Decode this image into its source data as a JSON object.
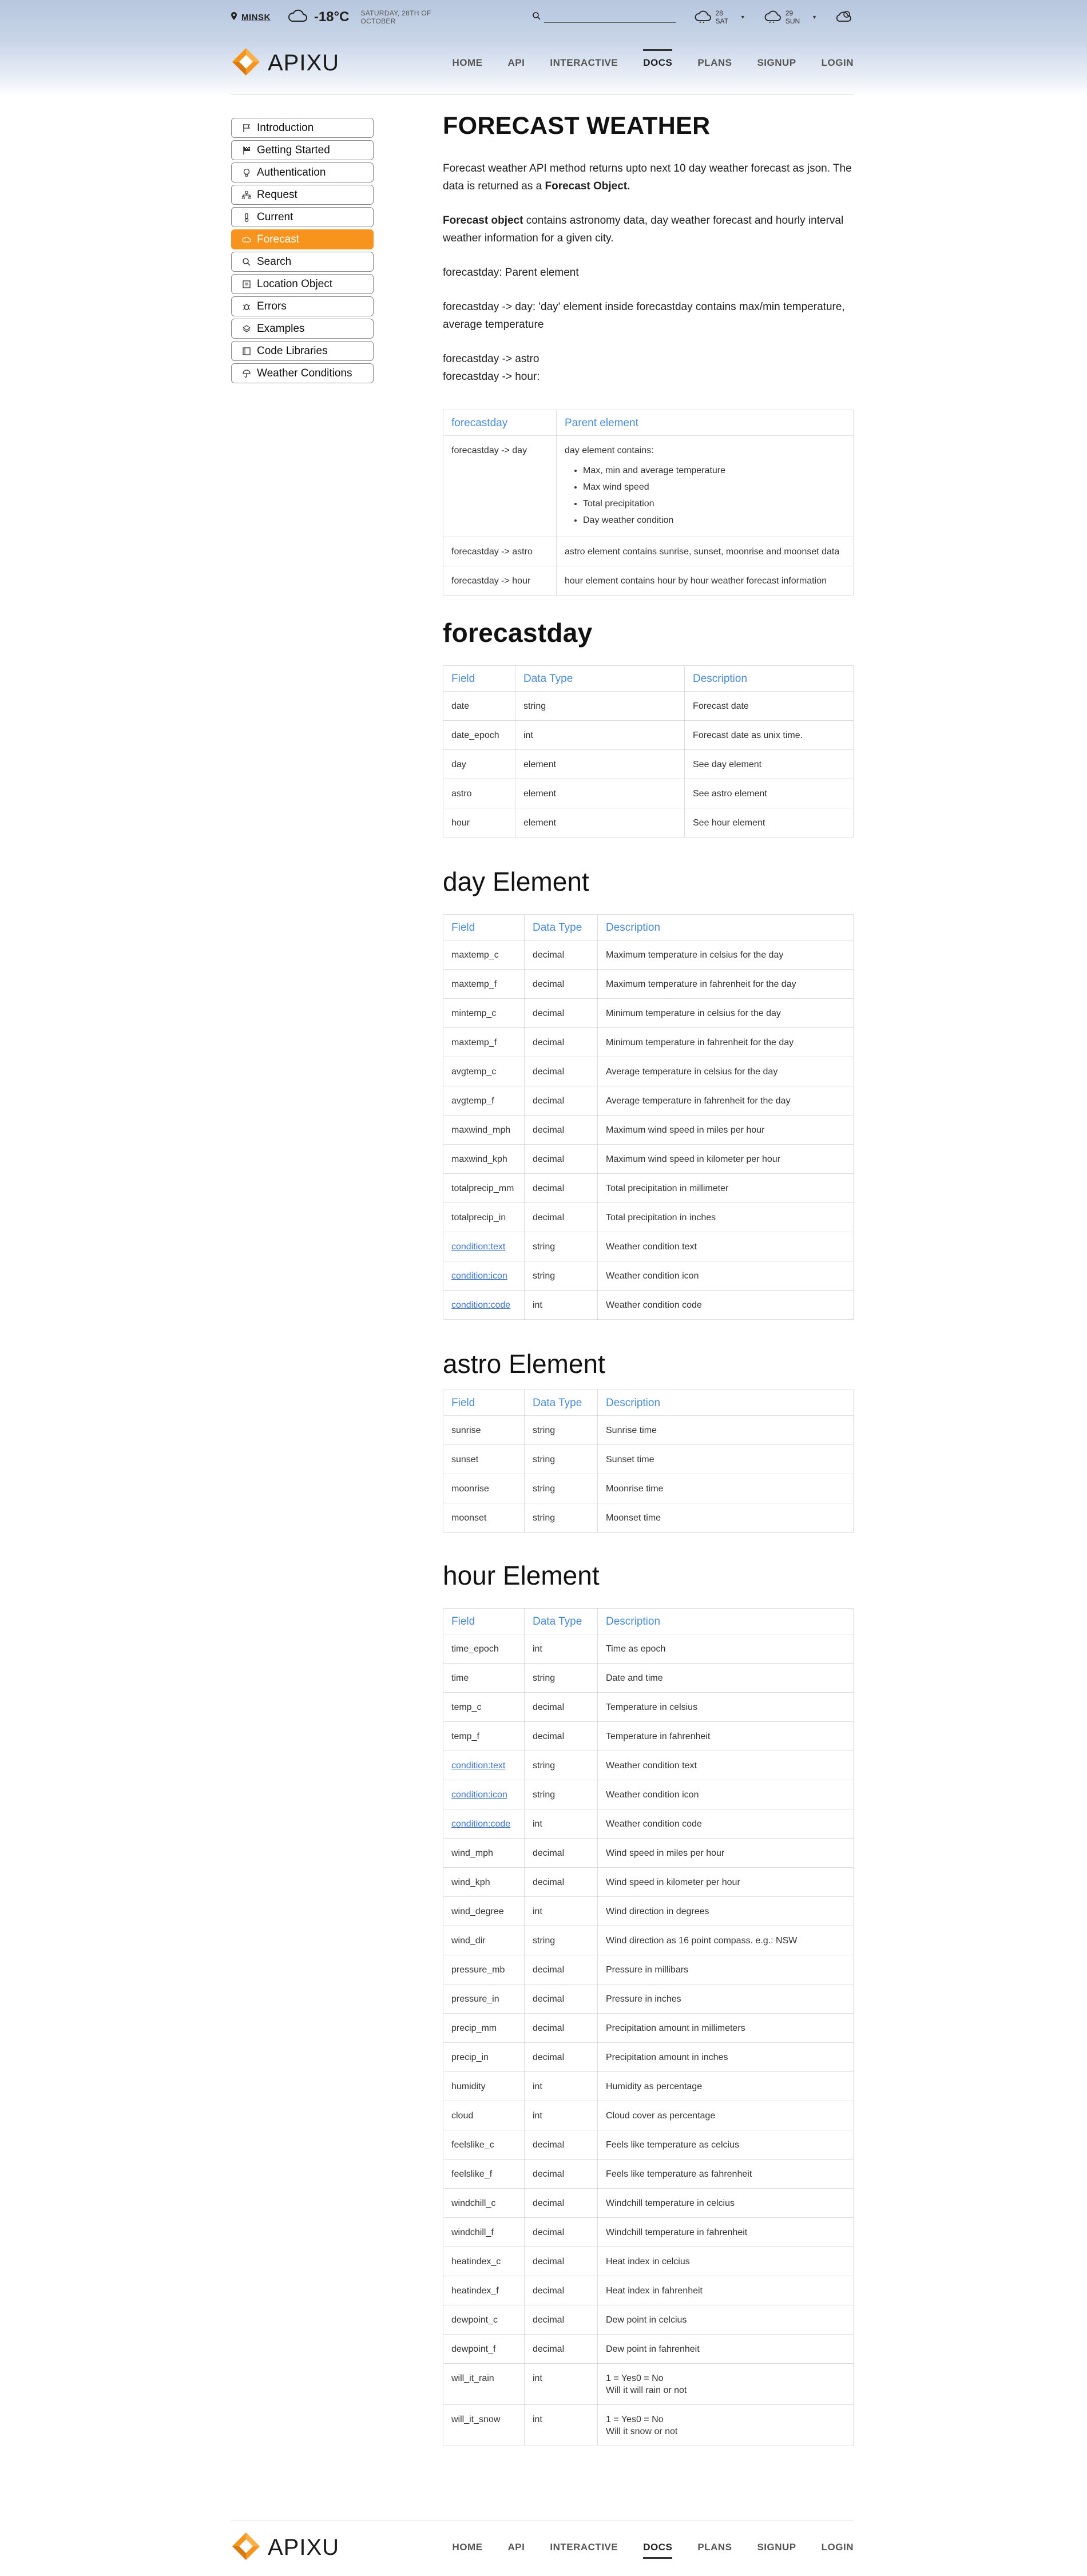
{
  "topbar": {
    "city": "MINSK",
    "temperature": "-18°C",
    "date": "SATURDAY, 28TH OF OCTOBER",
    "search_placeholder": "",
    "forecast_1": "28 SAT",
    "forecast_2": "29 SUN"
  },
  "brand": {
    "name": "APIXU",
    "logo_color": "#f7941d"
  },
  "nav": {
    "items": [
      {
        "label": "HOME"
      },
      {
        "label": "API"
      },
      {
        "label": "INTERACTIVE"
      },
      {
        "label": "DOCS",
        "active": true
      },
      {
        "label": "PLANS"
      },
      {
        "label": "SIGNUP"
      },
      {
        "label": "LOGIN"
      }
    ]
  },
  "sidebar": {
    "items": [
      {
        "label": "Introduction",
        "icon": "flag-icon"
      },
      {
        "label": "Getting Started",
        "icon": "checkered-flag-icon"
      },
      {
        "label": "Authentication",
        "icon": "lightbulb-icon"
      },
      {
        "label": "Request",
        "icon": "sitemap-icon"
      },
      {
        "label": "Current",
        "icon": "thermometer-icon"
      },
      {
        "label": "Forecast",
        "icon": "cloud-icon",
        "active": true
      },
      {
        "label": "Search",
        "icon": "search-icon"
      },
      {
        "label": "Location Object",
        "icon": "list-icon"
      },
      {
        "label": "Errors",
        "icon": "bug-icon"
      },
      {
        "label": "Examples",
        "icon": "layers-icon"
      },
      {
        "label": "Code Libraries",
        "icon": "book-icon"
      },
      {
        "label": "Weather Conditions",
        "icon": "umbrella-icon"
      }
    ],
    "active_color": "#f7941d"
  },
  "content": {
    "title": "FORECAST WEATHER",
    "intro_1": "Forecast weather API method returns upto next 10 day weather forecast as json. The data is returned as a ",
    "intro_1_bold": "Forecast Object.",
    "intro_2_bold": "Forecast object",
    "intro_2": " contains astronomy data, day weather forecast and hourly interval weather information for a given city.",
    "line_parent": "forecastday: Parent element",
    "line_day": "forecastday -> day: 'day' element inside forecastday contains max/min temperature, average temperature",
    "line_astro": "forecastday -> astro",
    "line_hour": "forecastday -> hour:"
  },
  "parent_table": {
    "headers": [
      "forecastday",
      "Parent element"
    ],
    "rows": [
      {
        "field": "forecastday -> day",
        "desc": "day element contains:",
        "bullets": [
          "Max, min and average temperature",
          "Max wind speed",
          "Total precipitation",
          "Day weather condition"
        ]
      },
      {
        "field": "forecastday -> astro",
        "desc": "astro element contains sunrise, sunset, moonrise and moonset data"
      },
      {
        "field": "forecastday -> hour",
        "desc": "hour element contains hour by hour weather forecast information"
      }
    ]
  },
  "forecastday_section": {
    "title": "forecastday",
    "headers": [
      "Field",
      "Data Type",
      "Description"
    ],
    "rows": [
      [
        "date",
        "string",
        "Forecast date"
      ],
      [
        "date_epoch",
        "int",
        "Forecast date as unix time."
      ],
      [
        "day",
        "element",
        "See day element"
      ],
      [
        "astro",
        "element",
        "See astro element"
      ],
      [
        "hour",
        "element",
        "See hour element"
      ]
    ]
  },
  "day_section": {
    "title": "day Element",
    "headers": [
      "Field",
      "Data Type",
      "Description"
    ],
    "rows": [
      [
        "maxtemp_c",
        "decimal",
        "Maximum temperature in celsius for the day"
      ],
      [
        "maxtemp_f",
        "decimal",
        "Maximum temperature in fahrenheit for the day"
      ],
      [
        "mintemp_c",
        "decimal",
        "Minimum temperature in celsius for the day"
      ],
      [
        "maxtemp_f",
        "decimal",
        "Minimum temperature in fahrenheit for the day"
      ],
      [
        "avgtemp_c",
        "decimal",
        "Average temperature in celsius for the day"
      ],
      [
        "avgtemp_f",
        "decimal",
        "Average temperature in fahrenheit for the day"
      ],
      [
        "maxwind_mph",
        "decimal",
        "Maximum wind speed in miles per hour"
      ],
      [
        "maxwind_kph",
        "decimal",
        "Maximum wind speed in kilometer per hour"
      ],
      [
        "totalprecip_mm",
        "decimal",
        "Total precipitation in millimeter"
      ],
      [
        "totalprecip_in",
        "decimal",
        "Total precipitation in inches"
      ],
      [
        "condition:text",
        "string",
        "Weather condition text"
      ],
      [
        "condition:icon",
        "string",
        "Weather condition icon"
      ],
      [
        "condition:code",
        "int",
        "Weather condition code"
      ]
    ]
  },
  "astro_section": {
    "title": "astro Element",
    "headers": [
      "Field",
      "Data Type",
      "Description"
    ],
    "rows": [
      [
        "sunrise",
        "string",
        "Sunrise time"
      ],
      [
        "sunset",
        "string",
        "Sunset time"
      ],
      [
        "moonrise",
        "string",
        "Moonrise time"
      ],
      [
        "moonset",
        "string",
        "Moonset time"
      ]
    ]
  },
  "hour_section": {
    "title": "hour Element",
    "headers": [
      "Field",
      "Data Type",
      "Description"
    ],
    "rows": [
      [
        "time_epoch",
        "int",
        "Time as epoch"
      ],
      [
        "time",
        "string",
        "Date and time"
      ],
      [
        "temp_c",
        "decimal",
        "Temperature in celsius"
      ],
      [
        "temp_f",
        "decimal",
        "Temperature in fahrenheit"
      ],
      [
        "condition:text",
        "string",
        "Weather condition text"
      ],
      [
        "condition:icon",
        "string",
        "Weather condition icon"
      ],
      [
        "condition:code",
        "int",
        "Weather condition code"
      ],
      [
        "wind_mph",
        "decimal",
        "Wind speed in miles per hour"
      ],
      [
        "wind_kph",
        "decimal",
        "Wind speed in kilometer per hour"
      ],
      [
        "wind_degree",
        "int",
        "Wind direction in degrees"
      ],
      [
        "wind_dir",
        "string",
        "Wind direction as 16 point compass. e.g.: NSW"
      ],
      [
        "pressure_mb",
        "decimal",
        "Pressure in millibars"
      ],
      [
        "pressure_in",
        "decimal",
        "Pressure in inches"
      ],
      [
        "precip_mm",
        "decimal",
        "Precipitation amount in millimeters"
      ],
      [
        "precip_in",
        "decimal",
        "Precipitation amount in inches"
      ],
      [
        "humidity",
        "int",
        "Humidity as percentage"
      ],
      [
        "cloud",
        "int",
        "Cloud cover as percentage"
      ],
      [
        "feelslike_c",
        "decimal",
        "Feels like temperature as celcius"
      ],
      [
        "feelslike_f",
        "decimal",
        "Feels like temperature as fahrenheit"
      ],
      [
        "windchill_c",
        "decimal",
        "Windchill temperature in celcius"
      ],
      [
        "windchill_f",
        "decimal",
        "Windchill temperature in fahrenheit"
      ],
      [
        "heatindex_c",
        "decimal",
        "Heat index in celcius"
      ],
      [
        "heatindex_f",
        "decimal",
        "Heat index in fahrenheit"
      ],
      [
        "dewpoint_c",
        "decimal",
        "Dew point in celcius"
      ],
      [
        "dewpoint_f",
        "decimal",
        "Dew point in fahrenheit"
      ],
      [
        "will_it_rain",
        "int",
        "1 = Yes0 = No\nWill it will rain or not"
      ],
      [
        "will_it_snow",
        "int",
        "1 = Yes0 = No\nWill it snow or not"
      ]
    ]
  },
  "link_fields": [
    "condition:text",
    "condition:icon",
    "condition:code"
  ]
}
